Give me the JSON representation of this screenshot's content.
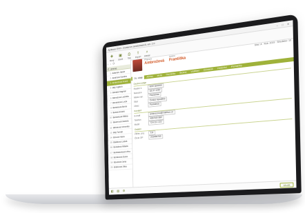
{
  "app": {
    "title": "Aplikace EVO - Evidence zaměstnanců, ver. 2.0",
    "window_controls": [
      "–",
      "□",
      "✕"
    ]
  },
  "toolbar": [
    {
      "icon": "new-icon",
      "glyph": "✚",
      "label": "Nový"
    },
    {
      "icon": "save-icon",
      "glyph": "▣",
      "label": "Uložit"
    },
    {
      "icon": "print-icon",
      "glyph": "⎙",
      "label": "Tisk"
    },
    {
      "icon": "export-icon",
      "glyph": "⇪",
      "label": "Export"
    },
    {
      "icon": "search-icon",
      "glyph": "⌕",
      "label": "Hledat"
    }
  ],
  "sidebar": {
    "nav": [
      "‹",
      "›",
      "⟳"
    ],
    "header": {
      "num": "Č",
      "name": "Jméno"
    },
    "rows": [
      {
        "num": "1",
        "name": "Adámek Jakub"
      },
      {
        "num": "2",
        "name": "Andrlová Sandra"
      },
      {
        "num": "3",
        "name": "Ambrožová Franti",
        "selected": true
      },
      {
        "num": "4",
        "name": "Bílý Vojtěch"
      },
      {
        "num": "5",
        "name": "Bohatá Dagmar"
      },
      {
        "num": "6",
        "name": "Benešová Ludmila"
      },
      {
        "num": "7",
        "name": "Beránková Lucie"
      },
      {
        "num": "8",
        "name": "Bartošová Alena"
      },
      {
        "num": "9",
        "name": "Bartoš Arnošt"
      },
      {
        "num": "10",
        "name": "Baránková Eliška"
      },
      {
        "num": "11",
        "name": "Bauerová Daniela"
      },
      {
        "num": "12",
        "name": "Bělohová Veronika"
      },
      {
        "num": "13",
        "name": "Bílý Tomáš"
      },
      {
        "num": "14",
        "name": "Bínová Hana"
      },
      {
        "num": "15",
        "name": "Blažková Luboš"
      },
      {
        "num": "16",
        "name": "Bohatová Milada"
      },
      {
        "num": "17",
        "name": "Bohdaneková Věra"
      },
      {
        "num": "18",
        "name": "Boháčová Dana"
      },
      {
        "num": "19",
        "name": "Boudová Jana"
      },
      {
        "num": "20",
        "name": "Brabcová Jitka"
      }
    ]
  },
  "person": {
    "first_label": "Příjmení",
    "first_value": "Ambrožová",
    "second_label": "Jméno",
    "second_value": "Františka",
    "right_items": [
      "Stav: A",
      "Rok: 2019",
      "Středisko: 10"
    ]
  },
  "tabs": [
    "Os. údaje",
    "Adresa",
    "Mzdy",
    "Docházka",
    "Školení",
    "Vzdělání",
    "Dovolená",
    "Zdravotní",
    "Poznámky"
  ],
  "form": {
    "section_main": "Osobní údaje",
    "rows": [
      {
        "label": "Rodné č.",
        "value": "905718/0000"
      },
      {
        "label": "Narozen",
        "value": "18.07.1990"
      },
      {
        "label": "Místo nar.",
        "value": "Pardubice"
      },
      {
        "label": "Stát",
        "value": "Česká republika"
      },
      {
        "label": "Obec",
        "value": "Pardubice"
      }
    ],
    "section_contact": "Kontakt",
    "contact_rows": [
      {
        "label": "E-mail",
        "value": "ambrozova@mailbox.cz"
      },
      {
        "label": "Telefon",
        "value": "466 544 882"
      },
      {
        "label": "Mobil",
        "value": "724 111 222"
      }
    ],
    "section_other": "Ostatní",
    "other_rows": [
      {
        "label": "Zdrav. poj.",
        "value": "111"
      },
      {
        "label": "Číslo OP",
        "value": "203456789"
      }
    ]
  },
  "statusbar": {
    "icons": [
      "◧",
      "▤",
      "⚙"
    ],
    "save_label": "Uložit"
  }
}
